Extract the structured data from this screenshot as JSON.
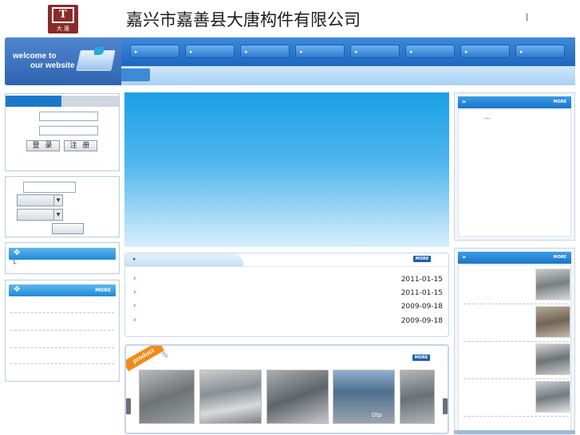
{
  "header": {
    "logo_letter": "T",
    "logo_caption": "大 唐",
    "company_name": "嘉兴市嘉善县大唐构件有限公司",
    "separator": "|"
  },
  "nav": {
    "welcome_line1": "welcome to",
    "welcome_line2": "our website",
    "items": [
      "",
      "",
      "",
      "",
      "",
      "",
      "",
      ""
    ],
    "arrow": "▸"
  },
  "login": {
    "login_button": "登 录",
    "register_button": "注 册"
  },
  "sections": {
    "more_label": "MORE",
    "ellipsis": "...",
    "left_corner_glyph": "└"
  },
  "news": {
    "items": [
      {
        "date": "2011-01-15"
      },
      {
        "date": "2011-01-15"
      },
      {
        "date": "2009-09-18"
      },
      {
        "date": "2009-09-18"
      }
    ]
  },
  "products": {
    "ribbon_label": "product",
    "photo_caption": "Dtp"
  },
  "colors": {
    "nav_blue": "#1f66bf",
    "accent_orange": "#f28a16",
    "section_header_blue": "#1a78c9",
    "news_arrow_red": "#b02a2a"
  }
}
